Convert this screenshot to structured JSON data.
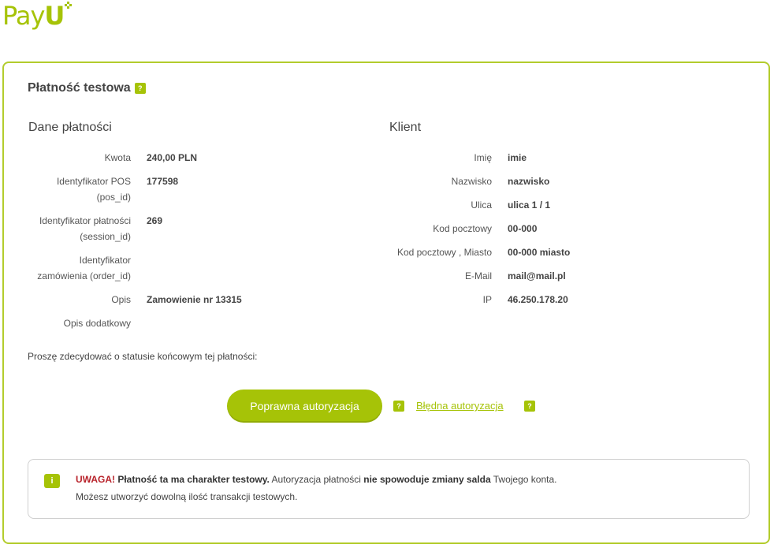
{
  "logo": {
    "text_a": "Pay",
    "text_b": "U"
  },
  "title": "Płatność testowa",
  "help_badge": "?",
  "payment": {
    "heading": "Dane płatności",
    "rows": [
      {
        "label_1": "Kwota",
        "label_2": "",
        "value": "240,00 PLN"
      },
      {
        "label_1": "Identyfikator POS",
        "label_2": "(pos_id)",
        "value": "177598"
      },
      {
        "label_1": "Identyfikator płatności",
        "label_2": "(session_id)",
        "value": "269"
      },
      {
        "label_1": "Identyfikator",
        "label_2": "zamówienia (order_id)",
        "value": ""
      },
      {
        "label_1": "Opis",
        "label_2": "",
        "value": "Zamowienie nr 13315"
      },
      {
        "label_1": "Opis dodatkowy",
        "label_2": "",
        "value": ""
      }
    ]
  },
  "client": {
    "heading": "Klient",
    "rows": [
      {
        "label": "Imię",
        "value": "imie"
      },
      {
        "label": "Nazwisko",
        "value": "nazwisko"
      },
      {
        "label": "Ulica",
        "value": "ulica 1 / 1"
      },
      {
        "label": "Kod pocztowy",
        "value": "00-000"
      },
      {
        "label": "Kod pocztowy , Miasto",
        "value": "00-000 miasto"
      },
      {
        "label": "E-Mail",
        "value": "mail@mail.pl"
      },
      {
        "label": "IP",
        "value": "46.250.178.20"
      }
    ]
  },
  "decision_prompt": "Proszę zdecydować o statusie końcowym tej płatności:",
  "actions": {
    "ok_label": "Poprawna autoryzacja",
    "bad_label": "Błędna autoryzacja"
  },
  "notice": {
    "icon": "i",
    "warn": "UWAGA!",
    "bold_1": " Płatność ta ma charakter testowy.",
    "text_1": " Autoryzacja płatności ",
    "bold_2": "nie spowoduje zmiany salda",
    "text_2": " Twojego konta.",
    "line_2": "Możesz utworzyć dowolną ilość transakcji testowych."
  },
  "colors": {
    "accent": "#a6c307",
    "warning": "#b8232b"
  }
}
